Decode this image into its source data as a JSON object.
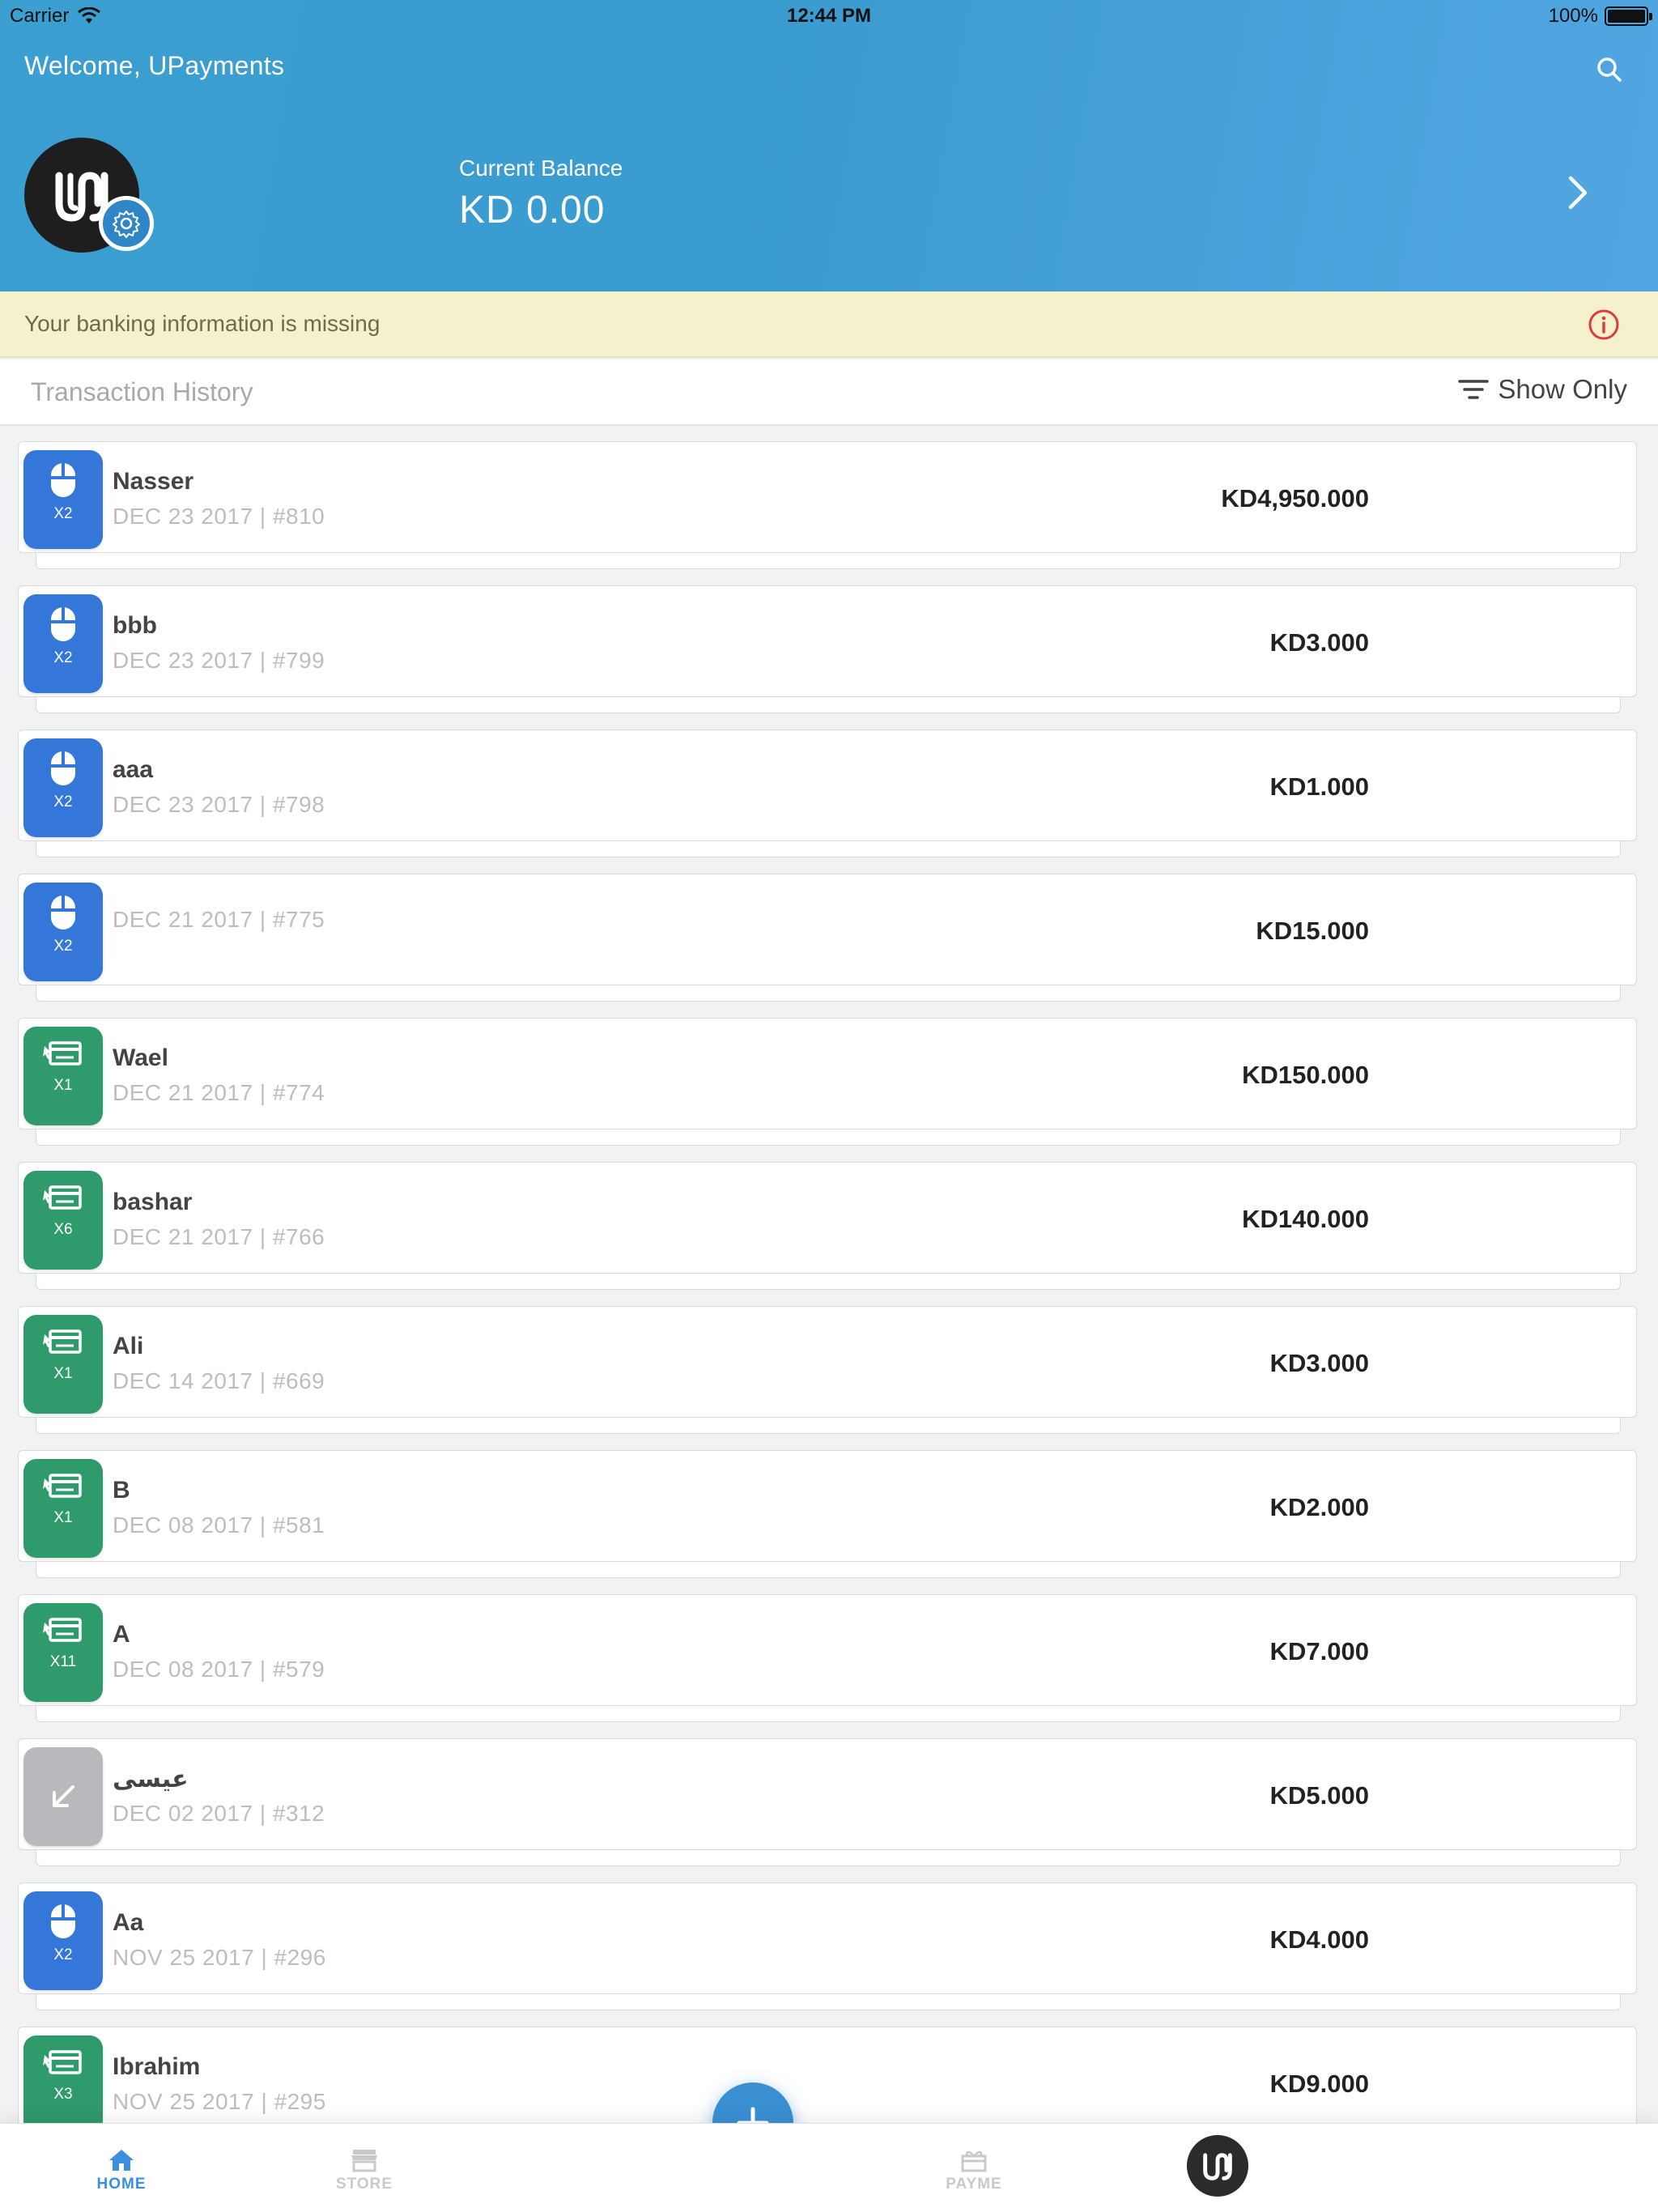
{
  "status_bar": {
    "carrier": "Carrier",
    "time": "12:44 PM",
    "battery": "100%"
  },
  "header": {
    "welcome": "Welcome, UPayments",
    "balance_label": "Current Balance",
    "balance_value": "KD 0.00"
  },
  "warning": {
    "text": "Your banking information is missing"
  },
  "history": {
    "title": "Transaction History",
    "filter_label": "Show Only"
  },
  "transactions": [
    {
      "name": "Nasser",
      "meta": "DEC 23 2017 | #810",
      "amount": "KD4,950.000",
      "type": "mouse",
      "color": "blue",
      "qty": "X2"
    },
    {
      "name": "bbb",
      "meta": "DEC 23 2017 | #799",
      "amount": "KD3.000",
      "type": "mouse",
      "color": "blue",
      "qty": "X2"
    },
    {
      "name": "aaa",
      "meta": "DEC 23 2017 | #798",
      "amount": "KD1.000",
      "type": "mouse",
      "color": "blue",
      "qty": "X2"
    },
    {
      "name": "",
      "meta": "DEC 21 2017 | #775",
      "amount": "KD15.000",
      "type": "mouse",
      "color": "blue",
      "qty": "X2"
    },
    {
      "name": "Wael",
      "meta": "DEC 21 2017 | #774",
      "amount": "KD150.000",
      "type": "card",
      "color": "green",
      "qty": "X1"
    },
    {
      "name": "bashar",
      "meta": "DEC 21 2017 | #766",
      "amount": "KD140.000",
      "type": "card",
      "color": "green",
      "qty": "X6"
    },
    {
      "name": "Ali",
      "meta": "DEC 14 2017 | #669",
      "amount": "KD3.000",
      "type": "card",
      "color": "green",
      "qty": "X1"
    },
    {
      "name": "B",
      "meta": "DEC 08 2017 | #581",
      "amount": "KD2.000",
      "type": "card",
      "color": "green",
      "qty": "X1"
    },
    {
      "name": "A",
      "meta": "DEC 08 2017 | #579",
      "amount": "KD7.000",
      "type": "card",
      "color": "green",
      "qty": "X11"
    },
    {
      "name": "عيسى",
      "meta": "DEC 02 2017 | #312",
      "amount": "KD5.000",
      "type": "arrow",
      "color": "gray",
      "qty": ""
    },
    {
      "name": "Aa",
      "meta": "NOV 25 2017 | #296",
      "amount": "KD4.000",
      "type": "mouse",
      "color": "blue",
      "qty": "X2"
    },
    {
      "name": "Ibrahim",
      "meta": "NOV 25 2017 | #295",
      "amount": "KD9.000",
      "type": "card",
      "color": "green",
      "qty": "X3"
    }
  ],
  "tabbar": {
    "home": "HOME",
    "store": "STORE",
    "payme": "PAYME"
  },
  "icons": {
    "search": "search-icon",
    "settings": "gear-icon",
    "chevron": "chevron-right-icon",
    "info": "info-icon",
    "filter": "filter-icon",
    "add": "plus-icon"
  },
  "colors": {
    "header": "#3b9fd1",
    "warning_bg": "#f6f1cd",
    "badge_blue": "#3577d8",
    "badge_green": "#2f9a6c",
    "badge_gray": "#b8b9bd",
    "accent": "#3a8fd3"
  }
}
